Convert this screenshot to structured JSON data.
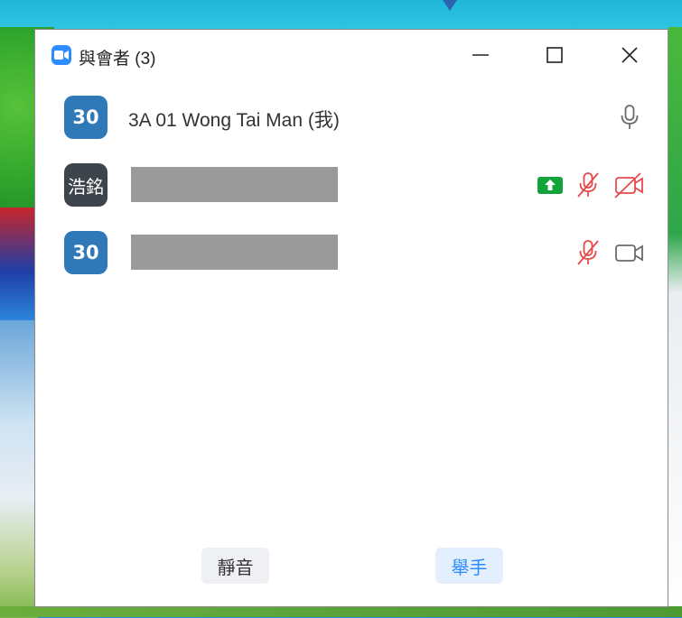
{
  "window": {
    "title": "與會者 (3)",
    "app_icon": "zoom-video-icon"
  },
  "participants": [
    {
      "avatar_text": "30",
      "avatar_color": "#2f79b8",
      "name": "3A 01 Wong Tai Man (我)",
      "mic": "on",
      "video": "none",
      "share": false
    },
    {
      "avatar_text": "浩銘",
      "avatar_color": "#3d444b",
      "name": "",
      "mic": "muted",
      "video": "off",
      "share": true
    },
    {
      "avatar_text": "30",
      "avatar_color": "#2f79b8",
      "name": "",
      "mic": "muted",
      "video": "on",
      "share": false
    }
  ],
  "footer": {
    "mute_label": "靜音",
    "raise_hand_label": "舉手"
  },
  "colors": {
    "accent": "#2d8cff",
    "muted_red": "#e54b4b",
    "share_green": "#12a33b"
  }
}
